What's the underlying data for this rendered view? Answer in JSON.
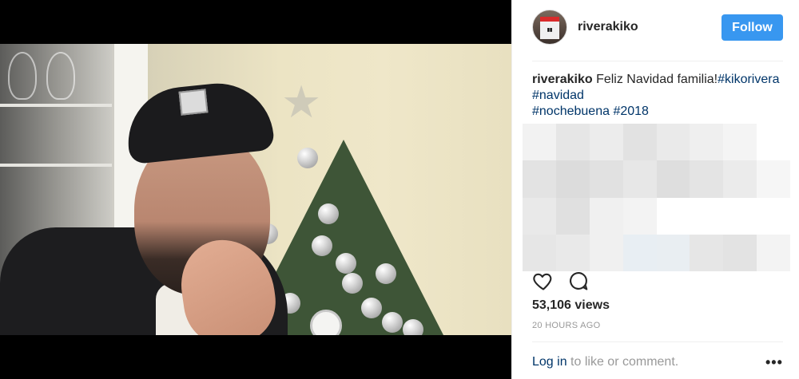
{
  "post": {
    "username": "riverakiko",
    "follow_label": "Follow",
    "caption": {
      "username": "riverakiko",
      "text": "Feliz Navidad familia!",
      "hashtags": [
        "#kikorivera",
        "#navidad",
        "#nochebuena",
        "#2018"
      ]
    },
    "views": "53,106 views",
    "timestamp": "20 HOURS AGO",
    "footer": {
      "login_link": "Log in",
      "login_suffix": "to like or comment.",
      "more_icon": "ellipsis-icon"
    },
    "icons": {
      "like": "heart-icon",
      "comment": "comment-bubble-icon"
    }
  },
  "colors": {
    "follow_button": "#3897f0",
    "hashtag_link": "#003569",
    "muted_text": "#999999",
    "media_background": "#000000"
  }
}
